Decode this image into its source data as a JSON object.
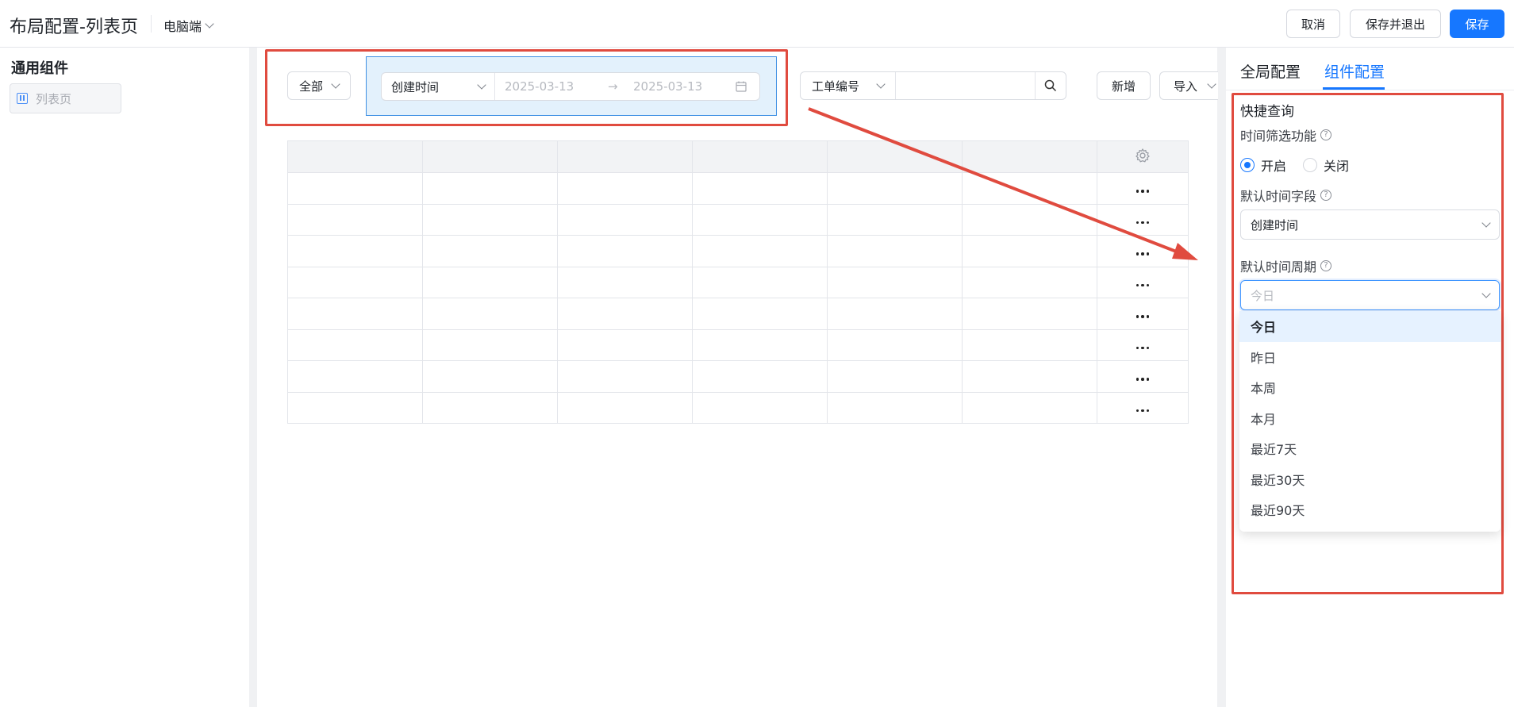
{
  "header": {
    "title": "布局配置-列表页",
    "device": "电脑端",
    "buttons": {
      "cancel": "取消",
      "save_exit": "保存并退出",
      "save": "保存"
    }
  },
  "left_panel": {
    "title": "通用组件",
    "items": [
      {
        "label": "列表页",
        "icon": "list-page-icon"
      }
    ]
  },
  "canvas": {
    "filter_all": "全部",
    "date_field": "创建时间",
    "date_start": "2025-03-13",
    "date_arrow": "→",
    "date_end": "2025-03-13",
    "work_order_field": "工单编号",
    "search_value": "",
    "actions": {
      "add": "新增",
      "import": "导入"
    },
    "table": {
      "columns": 7,
      "rows": 8,
      "row_action": "•••"
    }
  },
  "right_panel": {
    "tabs": [
      {
        "label": "全局配置",
        "active": false
      },
      {
        "label": "组件配置",
        "active": true
      }
    ],
    "section_title": "快捷查询",
    "time_filter": {
      "label": "时间筛选功能",
      "options": [
        {
          "label": "开启",
          "checked": true
        },
        {
          "label": "关闭",
          "checked": false
        }
      ]
    },
    "default_time_field": {
      "label": "默认时间字段",
      "value": "创建时间"
    },
    "default_time_period": {
      "label": "默认时间周期",
      "placeholder": "今日",
      "options": [
        "今日",
        "昨日",
        "本周",
        "本月",
        "最近7天",
        "最近30天",
        "最近90天"
      ],
      "selected": "今日"
    }
  },
  "colors": {
    "accent": "#1677ff",
    "annotation_red": "#e04b3f",
    "date_group_bg": "#e3f1fc"
  }
}
